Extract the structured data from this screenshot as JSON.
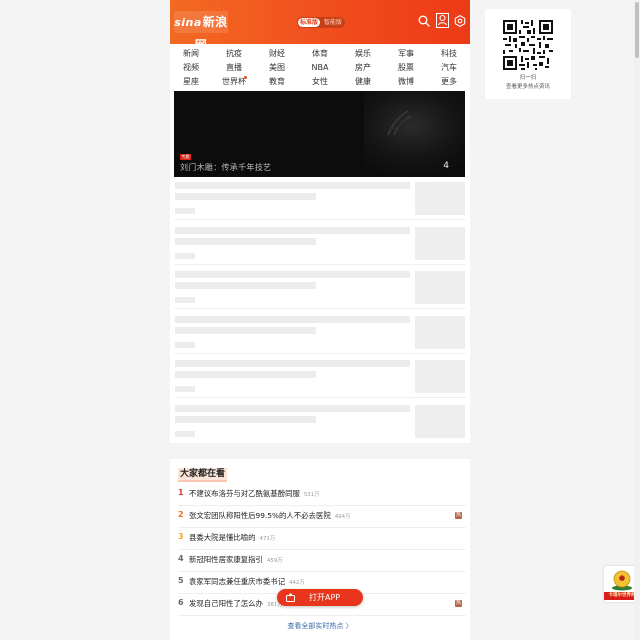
{
  "brand": {
    "logo_text": "新浪网",
    "logo_eye": "sina",
    "primary_color": "#f14a1c"
  },
  "header": {
    "mode_standard": "标准版",
    "mode_smart": "智能版",
    "icons": [
      "search-icon",
      "user-icon",
      "settings-icon"
    ]
  },
  "nav": {
    "rows": [
      [
        "新闻",
        "抗疫",
        "财经",
        "体育",
        "娱乐",
        "军事",
        "科技"
      ],
      [
        "视频",
        "直播",
        "美图",
        "NBA",
        "房产",
        "股票",
        "汽车"
      ],
      [
        "星座",
        "世界杯",
        "教育",
        "女性",
        "健康",
        "微博",
        "更多"
      ]
    ]
  },
  "banner": {
    "tag": "专题",
    "caption": "刘门木雕：传承千年技艺",
    "count": "4"
  },
  "hot": {
    "title": "大家都在看",
    "items": [
      {
        "rank": "1",
        "text": "不建议布洛芬与对乙酰氨基酚同服",
        "count": "531万",
        "badge": ""
      },
      {
        "rank": "2",
        "text": "张文宏团队称阳性后99.5%的人不必去医院",
        "count": "494万",
        "badge": "热"
      },
      {
        "rank": "3",
        "text": "县委大院是懂比喻的",
        "count": "471万",
        "badge": ""
      },
      {
        "rank": "4",
        "text": "新冠阳性居家康复指引",
        "count": "459万",
        "badge": ""
      },
      {
        "rank": "5",
        "text": "袁家军同志兼任重庆市委书记",
        "count": "442万",
        "badge": ""
      },
      {
        "rank": "6",
        "text": "发现自己阳性了怎么办",
        "count": "381万",
        "badge": "热"
      }
    ],
    "rank_colors": [
      "#e4393c",
      "#f36b1c",
      "#f5a623",
      "#666666",
      "#666666",
      "#666666"
    ],
    "more": "查看全部实时热点 〉"
  },
  "open_app": "打开APP",
  "qr": {
    "line1": "扫一扫",
    "line2": "查看更多热点资讯"
  },
  "promo": {
    "label": "卡塔尔世界杯"
  }
}
